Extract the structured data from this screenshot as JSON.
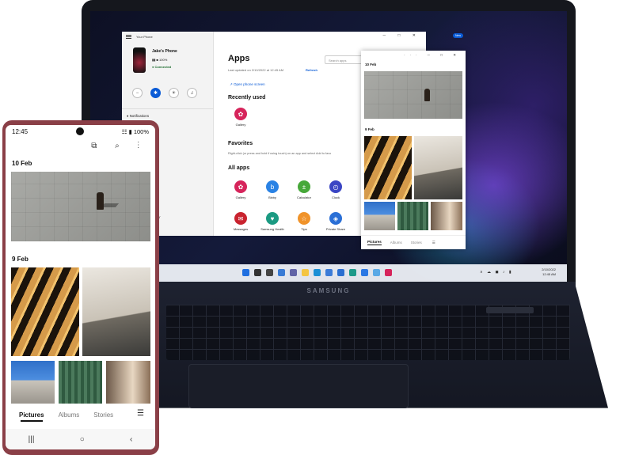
{
  "laptop": {
    "brand": "SAMSUNG"
  },
  "phone_link": {
    "window_title": "Your Phone",
    "new_badge": "New",
    "window_controls": "─ □ ✕",
    "phone_name": "Jake's Phone",
    "phone_status": "▮▮ ■ 100%",
    "connection": "● Connected",
    "notifications_label": "Notifications",
    "contact_fragment": "kbar",
    "apps_title": "Apps",
    "search_placeholder": "Search apps",
    "last_updated": "Last updated on 2/10/2022 at 12:45 AM",
    "refresh": "Refresh",
    "open_phone_screen": "Open phone screen",
    "recently_used_title": "Recently used",
    "recently_used": [
      {
        "name": "Gallery",
        "color": "#d6245b",
        "glyph": "✿"
      }
    ],
    "favorites_title": "Favorites",
    "favorites_desc": "Right-click (or press and hold if using touch) on an app and select Add to favo",
    "all_apps_title": "All apps",
    "all_apps": [
      {
        "name": "Gallery",
        "color": "#d6245b",
        "glyph": "✿"
      },
      {
        "name": "Bixby",
        "color": "#2a82e4",
        "glyph": "b"
      },
      {
        "name": "Calculator",
        "color": "#47a83a",
        "glyph": "±"
      },
      {
        "name": "Clock",
        "color": "#3b46c4",
        "glyph": "◴"
      },
      {
        "name": "Messages",
        "color": "#c9232f",
        "glyph": "✉"
      },
      {
        "name": "Samsung Health",
        "color": "#1b9a82",
        "glyph": "♥"
      },
      {
        "name": "Tips",
        "color": "#f0932a",
        "glyph": "☆"
      },
      {
        "name": "Private Share",
        "color": "#2a6fd6",
        "glyph": "◈"
      }
    ]
  },
  "gallery_window": {
    "window_controls": "··· ─ □ ✕",
    "dates": [
      "10 Feb",
      "9 Feb"
    ],
    "tabs": [
      "Pictures",
      "Albums",
      "Stories"
    ],
    "menu_icon": "☰"
  },
  "taskbar": {
    "time": "12:45 AM",
    "date": "2/10/2022",
    "tray": "∧ ☁ ◼ ♪ ▮",
    "icons": [
      {
        "name": "start",
        "color": "#1f6fe0"
      },
      {
        "name": "search",
        "color": "#333333"
      },
      {
        "name": "task-view",
        "color": "#444444"
      },
      {
        "name": "widgets",
        "color": "#3a7bd5"
      },
      {
        "name": "chat",
        "color": "#6264a7"
      },
      {
        "name": "file-explorer",
        "color": "#f4c543"
      },
      {
        "name": "edge",
        "color": "#1b8fd6"
      },
      {
        "name": "store",
        "color": "#3b7bd8"
      },
      {
        "name": "phone-link",
        "color": "#2b6fd1"
      },
      {
        "name": "app-teal",
        "color": "#1d9a8a"
      },
      {
        "name": "app-blue",
        "color": "#2b78e4"
      },
      {
        "name": "app-lightblue",
        "color": "#5aa9e6"
      },
      {
        "name": "gallery",
        "color": "#d6245b"
      }
    ]
  },
  "phone": {
    "time": "12:45",
    "status_right": "☷ ▮ 100%",
    "top_icons": "⧉ ⌕ ⋮",
    "dates": [
      "10 Feb",
      "9 Feb"
    ],
    "tabs": [
      "Pictures",
      "Albums",
      "Stories"
    ],
    "menu_icon": "☰",
    "nav": [
      "|||",
      "○",
      "‹"
    ]
  }
}
